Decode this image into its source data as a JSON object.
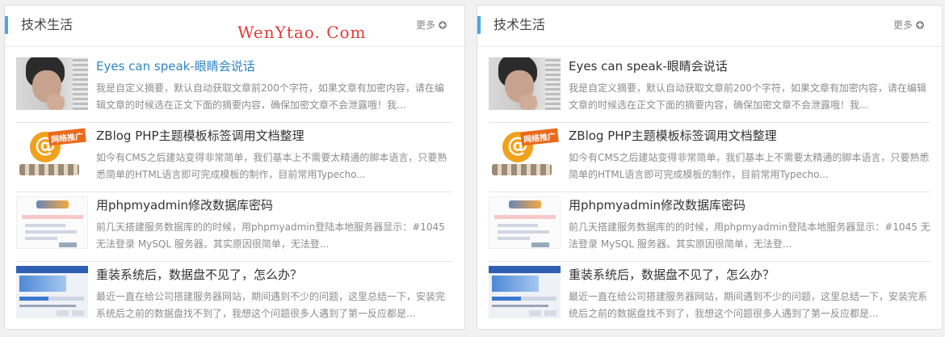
{
  "watermark": "WenYtao. Com",
  "panels": [
    {
      "title": "技术生活",
      "more_label": "更多",
      "items": [
        {
          "title": "Eyes can speak-眼睛会说话",
          "desc": "我是自定义摘要，默认自动获取文章前200个字符，如果文章有加密内容，请在编辑文章的时候选在正文下面的摘要内容，确保加密文章不会泄露哦！我..."
        },
        {
          "title": "ZBlog PHP主题模板标签调用文档整理",
          "desc": "如今有CMS之后建站变得非常简单，我们基本上不需要太精通的脚本语言，只要熟悉简单的HTML语言即可完成模板的制作，目前常用Typecho..."
        },
        {
          "title": "用phpmyadmin修改数据库密码",
          "desc": "前几天搭建服务数据库的的时候，用phpmyadmin登陆本地服务器显示：#1045 无法登录 MySQL 服务器。其实原因很简单，无法登..."
        },
        {
          "title": "重装系统后，数据盘不见了，怎么办？",
          "desc": "最近一直在给公司搭建服务器网站，期间遇到不少的问题，这里总结一下，安装完系统后之前的数据盘找不到了，我想这个问题很多人遇到了第一反应都是..."
        }
      ]
    },
    {
      "title": "技术生活",
      "more_label": "更多",
      "items": [
        {
          "title": "Eyes can speak-眼睛会说话",
          "desc": "我是自定义摘要，默认自动获取文章前200个字符，如果文章有加密内容，请在编辑文章的时候选在正文下面的摘要内容，确保加密文章不会泄露哦！我..."
        },
        {
          "title": "ZBlog PHP主题模板标签调用文档整理",
          "desc": "如今有CMS之后建站变得非常简单，我们基本上不需要太精通的脚本语言，只要熟悉简单的HTML语言即可完成模板的制作，目前常用Typecho..."
        },
        {
          "title": "用phpmyadmin修改数据库密码",
          "desc": "前几天搭建服务数据库的的时候，用phpmyadmin登陆本地服务器显示：#1045 无法登录 MySQL 服务器。其实原因很简单，无法登..."
        },
        {
          "title": "重装系统后，数据盘不见了，怎么办？",
          "desc": "最近一直在给公司搭建服务器网站，期间遇到不少的问题，这里总结一下，安装完系统后之前的数据盘找不到了，我想这个问题很多人遇到了第一反应都是..."
        }
      ]
    }
  ],
  "thumb_labels": {
    "network": "网络推广"
  },
  "colors": {
    "accent": "#4aa7e6",
    "link_active": "#2f86c7",
    "watermark": "#e23b37"
  }
}
